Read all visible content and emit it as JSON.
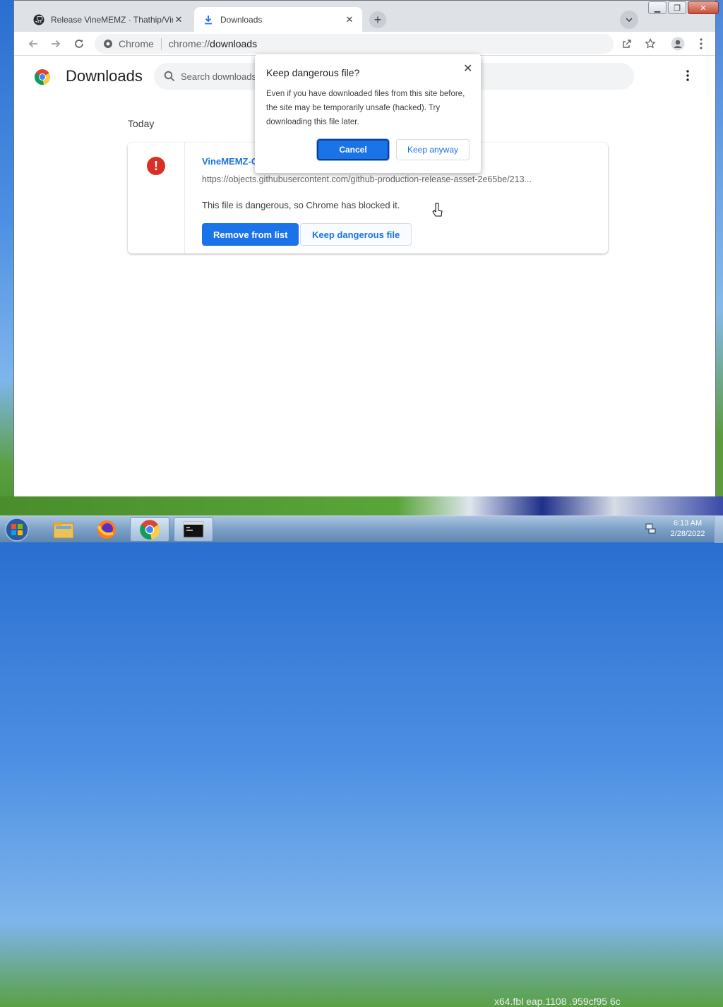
{
  "browser": {
    "tabs": [
      {
        "title": "Release VineMEMZ · Thathip/VineMEMZ",
        "active": false,
        "icon": "github-icon"
      },
      {
        "title": "Downloads",
        "active": true,
        "icon": "download-icon"
      }
    ],
    "omnibox": {
      "site_label": "Chrome",
      "url_prefix": "chrome://",
      "url_path": "downloads"
    }
  },
  "downloads_page": {
    "title": "Downloads",
    "search_placeholder": "Search downloads",
    "section": "Today",
    "item": {
      "file_name": "VineMEMZ-C",
      "url": "https://objects.githubusercontent.com/github-production-release-asset-2e65be/213...",
      "status": "This file is dangerous, so Chrome has blocked it.",
      "remove_label": "Remove from list",
      "keep_label": "Keep dangerous file"
    }
  },
  "dialog": {
    "title": "Keep dangerous file?",
    "body": "Even if you have downloaded files from this site before, the site may be temporarily unsafe (hacked). Try downloading this file later.",
    "cancel_label": "Cancel",
    "keep_label": "Keep anyway"
  },
  "desktop": {
    "overlay_text": "x64.fbl  eap.1108         .959cf95         6c"
  },
  "taskbar": {
    "time": "6:13 AM",
    "date": "2/28/2022"
  },
  "colors": {
    "accent": "#1a73e8",
    "danger": "#d93025"
  }
}
